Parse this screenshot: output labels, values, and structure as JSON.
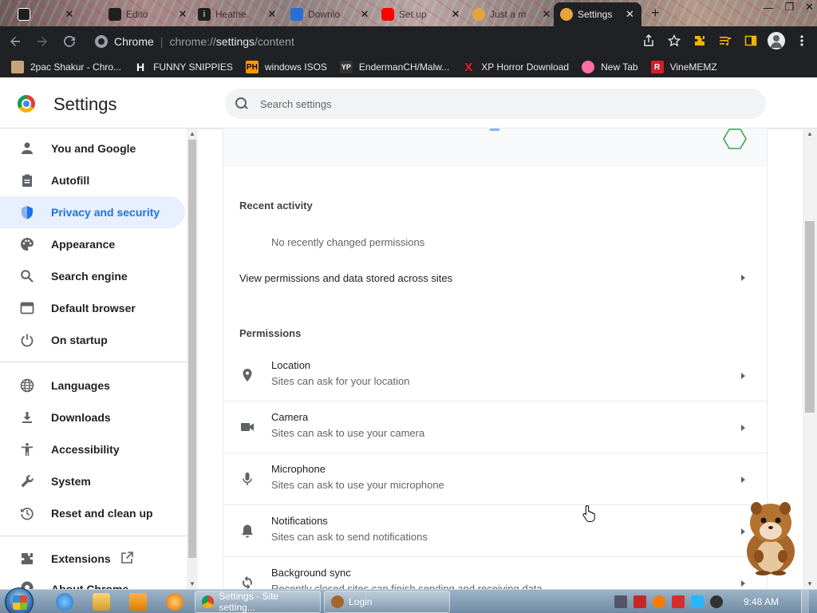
{
  "tabs": [
    {
      "label": "",
      "icon": "calendar-icon",
      "color": "#ffffff"
    },
    {
      "label": "Edito",
      "icon": "shield-icon",
      "color": "#1f1f1f"
    },
    {
      "label": "Heathe",
      "icon": "info-icon",
      "color": "#1f1f1f"
    },
    {
      "label": "Downlo",
      "icon": "download-icon",
      "color": "#2a6fd6"
    },
    {
      "label": "Set up",
      "icon": "youtube-icon",
      "color": "#ff0000"
    },
    {
      "label": "Just a m",
      "icon": "spinner-icon",
      "color": "#e6a23c"
    },
    {
      "label": "Settings",
      "icon": "gear-icon",
      "color": "#e6a23c",
      "active": true
    }
  ],
  "toolbar": {
    "site_chip": "Chrome",
    "url_scheme": "chrome://",
    "url_host": "settings",
    "url_path": "/content"
  },
  "bookmarks": [
    {
      "label": "2pac Shakur - Chro...",
      "icon": "shakur-icon",
      "color": "#c8a37a"
    },
    {
      "label": "FUNNY SNIPPIES",
      "icon": "h-icon",
      "color": "#ffffff"
    },
    {
      "label": "windows ISOS",
      "icon": "ph-icon",
      "color": "#ff9900"
    },
    {
      "label": "EndermanCH/Malw...",
      "icon": "yp-icon",
      "color": "#333333"
    },
    {
      "label": "XP Horror Download",
      "icon": "x-icon",
      "color": "#e02020"
    },
    {
      "label": "New Tab",
      "icon": "newtab-icon",
      "color": "#ff6fa0"
    },
    {
      "label": "VineMEMZ",
      "icon": "r-icon",
      "color": "#d0202a"
    }
  ],
  "header": {
    "title": "Settings",
    "search_placeholder": "Search settings"
  },
  "sidebar": {
    "items": [
      {
        "label": "You and Google",
        "icon": "person-icon"
      },
      {
        "label": "Autofill",
        "icon": "clipboard-icon"
      },
      {
        "label": "Privacy and security",
        "icon": "shield-icon",
        "active": true
      },
      {
        "label": "Appearance",
        "icon": "palette-icon"
      },
      {
        "label": "Search engine",
        "icon": "search-icon"
      },
      {
        "label": "Default browser",
        "icon": "browser-icon"
      },
      {
        "label": "On startup",
        "icon": "power-icon"
      },
      {
        "label": "Languages",
        "icon": "globe-icon"
      },
      {
        "label": "Downloads",
        "icon": "download-icon"
      },
      {
        "label": "Accessibility",
        "icon": "accessibility-icon"
      },
      {
        "label": "System",
        "icon": "wrench-icon"
      },
      {
        "label": "Reset and clean up",
        "icon": "history-icon"
      },
      {
        "label": "Extensions",
        "icon": "puzzle-icon"
      },
      {
        "label": "About Chrome",
        "icon": "chrome-icon"
      }
    ]
  },
  "content": {
    "recent_activity_title": "Recent activity",
    "no_recent": "No recently changed permissions",
    "view_permissions_link": "View permissions and data stored across sites",
    "permissions_title": "Permissions",
    "permissions": [
      {
        "title": "Location",
        "subtitle": "Sites can ask for your location",
        "icon": "location-icon"
      },
      {
        "title": "Camera",
        "subtitle": "Sites can ask to use your camera",
        "icon": "camera-icon"
      },
      {
        "title": "Microphone",
        "subtitle": "Sites can ask to use your microphone",
        "icon": "microphone-icon"
      },
      {
        "title": "Notifications",
        "subtitle": "Sites can ask to send notifications",
        "icon": "bell-icon"
      },
      {
        "title": "Background sync",
        "subtitle": "Recently closed sites can finish sending and receiving data",
        "icon": "sync-icon"
      }
    ]
  },
  "taskbar": {
    "tasks": [
      {
        "label": "Settings - Site setting...",
        "icon": "chrome-icon"
      },
      {
        "label": "Login",
        "icon": "login-icon"
      }
    ],
    "clock": "9:48 AM"
  },
  "colors": {
    "accent": "#1a73e8",
    "active_bg": "#e8f0fe",
    "toolbar_bg": "#202124"
  }
}
